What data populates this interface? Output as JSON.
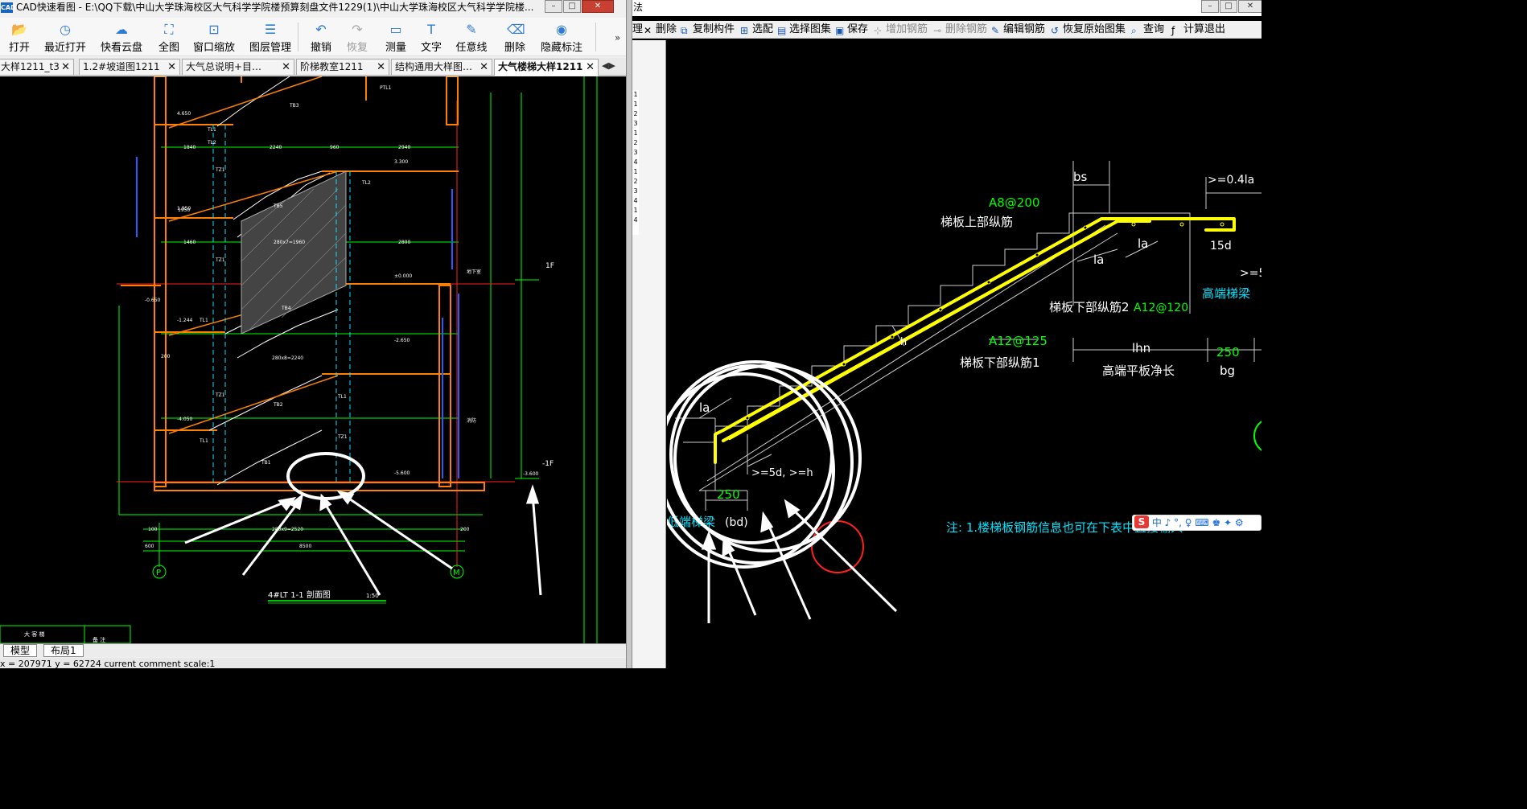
{
  "left": {
    "title": "CAD快速看图 - E:\\QQ下载\\中山大学珠海校区大气科学学院楼预算刻盘文件1229(1)\\中山大学珠海校区大气科学学院楼...",
    "app_icon": "CAD",
    "toolbar": [
      {
        "label": "打开",
        "icon": "folder-open-icon",
        "enabled": true
      },
      {
        "label": "最近打开",
        "icon": "recent-clock-icon",
        "enabled": true
      },
      {
        "label": "快看云盘",
        "icon": "cloud-icon",
        "enabled": true
      },
      {
        "label": "全图",
        "icon": "fullview-icon",
        "enabled": true
      },
      {
        "label": "窗口缩放",
        "icon": "window-zoom-icon",
        "enabled": true
      },
      {
        "label": "图层管理",
        "icon": "layers-icon",
        "enabled": true
      },
      {
        "label": "撤销",
        "icon": "undo-icon",
        "enabled": true
      },
      {
        "label": "恢复",
        "icon": "redo-icon",
        "enabled": false
      },
      {
        "label": "测量",
        "icon": "measure-icon",
        "enabled": true
      },
      {
        "label": "文字",
        "icon": "text-icon",
        "enabled": true
      },
      {
        "label": "任意线",
        "icon": "freeline-icon",
        "enabled": true
      },
      {
        "label": "删除",
        "icon": "eraser-icon",
        "enabled": true
      },
      {
        "label": "隐藏标注",
        "icon": "eye-hide-icon",
        "enabled": true
      }
    ],
    "more": "»",
    "tabs": [
      {
        "label": "大样1211_t3",
        "active": false
      },
      {
        "label": "1.2#坡道图1211",
        "active": false
      },
      {
        "label": "大气总说明+目…",
        "active": false
      },
      {
        "label": "阶梯教室1211",
        "active": false
      },
      {
        "label": "结构通用大样图…",
        "active": false
      },
      {
        "label": "大气楼梯大样1211",
        "active": true
      }
    ],
    "bottom_tabs": [
      "模型",
      "布局1"
    ],
    "status": "x = 207971  y = 62724    current comment scale:1",
    "drawing": {
      "caption": "4#LT 1-1 剖面图",
      "caption_scale": "1:50",
      "axis_p": "P",
      "axis_m": "M",
      "level_1f": "1F",
      "level_m1f": "-1F",
      "elev": [
        "4.650",
        "3.300",
        "1.950",
        "±0.000",
        "-0.650",
        "-1.244",
        "-2.650",
        "-4.050",
        "-5.600",
        "-3.600"
      ],
      "dims": [
        "1840",
        "2240",
        "2940",
        "960",
        "1460",
        "1950",
        "200",
        "8500",
        "600",
        "100",
        "1850",
        "2320",
        "1840",
        "5400",
        "1690",
        "850",
        "280x7=1960",
        "280x8=2240",
        "280x9=2520",
        "2800",
        "200"
      ],
      "labels": [
        "TB3",
        "TB5",
        "TB4",
        "TB2",
        "TB1",
        "TL1",
        "TL2",
        "TZ1",
        "TZ1",
        "TZ1",
        "TZ1",
        "TL1",
        "TL1",
        "PTL1",
        "TL2",
        "TL1",
        "TB6",
        "TB1",
        "TB2",
        "TB3",
        "消防",
        "地下室"
      ],
      "legend_text": [
        "大 客 梯",
        "备 注"
      ]
    }
  },
  "right": {
    "title_char": "法",
    "toolbar": [
      {
        "label": "理",
        "icon": "",
        "enabled": true
      },
      {
        "label": "删除",
        "icon": "delete-x-icon",
        "enabled": true
      },
      {
        "label": "复制构件",
        "icon": "copy-icon",
        "enabled": true
      },
      {
        "label": "选配",
        "icon": "select-icon",
        "enabled": true
      },
      {
        "label": "选择图集",
        "icon": "atlas-icon",
        "enabled": true
      },
      {
        "label": "保存",
        "icon": "save-icon",
        "enabled": true
      },
      {
        "label": "增加钢筋",
        "icon": "add-rebar-icon",
        "enabled": false
      },
      {
        "label": "删除钢筋",
        "icon": "delete-rebar-icon",
        "enabled": false
      },
      {
        "label": "编辑钢筋",
        "icon": "edit-rebar-icon",
        "enabled": true
      },
      {
        "label": "恢复原始图集",
        "icon": "restore-icon",
        "enabled": true
      },
      {
        "label": "查询",
        "icon": "query-icon",
        "enabled": true
      },
      {
        "label": "计算退出",
        "icon": "calc-exit-icon",
        "enabled": true
      }
    ],
    "side_numbers": [
      "1",
      "1",
      "2",
      "3",
      "1",
      "2",
      "3",
      "4",
      "1",
      "2",
      "3",
      "4",
      "1",
      "4"
    ],
    "drawing": {
      "bs": "bs",
      "gte_04la": ">=0.4la",
      "a8": "A8@200",
      "top_rebar": "梯板上部纵筋",
      "la1": "la",
      "la2": "la",
      "la3": "la",
      "d15": "15d",
      "gte_5d": ">=5d",
      "high_beam": "高端梯梁",
      "lower2": "梯板下部纵筋2",
      "a12_120": "A12@120",
      "h": "h",
      "a12_125": "A12@125",
      "lhn": "lhn",
      "v250a": "250",
      "lower1": "梯板下部纵筋1",
      "high_slab": "高端平板净长",
      "bg": "bg",
      "gte5dh": ">=5d, >=h",
      "v250b": "250",
      "low_beam": "低端梯梁",
      "bd": "(bd)",
      "note": "注: 1.楼梯板钢筋信息也可在下表中直接输入"
    },
    "ime_text": "中 ♪ °, ♀ ⌨ ♚ ✦ ⚙"
  },
  "colors": {
    "cad_bg": "#000000",
    "rebar_yellow": "#ffff00",
    "label_green": "#00ff00",
    "label_cyan": "#00e5ff",
    "annotation_white": "#ffffff",
    "wall_orange": "#ff8000"
  }
}
